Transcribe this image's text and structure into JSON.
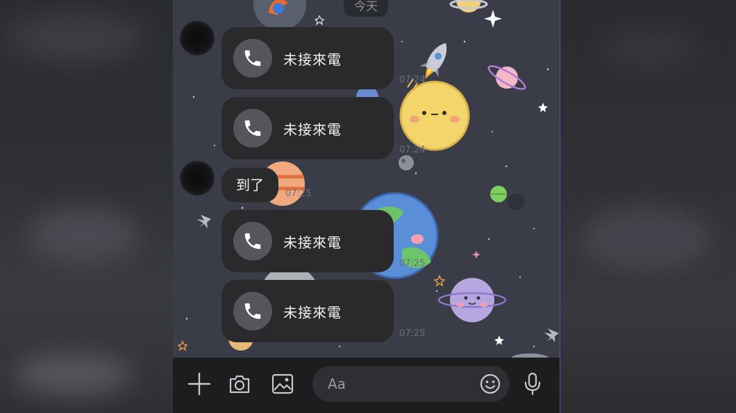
{
  "chat": {
    "date_divider": "今天",
    "messages": [
      {
        "type": "missed_call",
        "label": "未接來電",
        "time": "07:24"
      },
      {
        "type": "missed_call",
        "label": "未接來電",
        "time": "07:24"
      },
      {
        "type": "text",
        "text": "到了",
        "time": "07:25"
      },
      {
        "type": "missed_call",
        "label": "未接來電",
        "time": "07:25"
      },
      {
        "type": "missed_call",
        "label": "未接來電",
        "time": "07:25"
      }
    ]
  },
  "input": {
    "placeholder": "Aa"
  },
  "icons": {
    "add": "plus-icon",
    "camera": "camera-icon",
    "gallery": "image-icon",
    "emoji": "smiley-icon",
    "voice": "microphone-icon",
    "call": "phone-handset-icon"
  },
  "colors": {
    "wallpaper": "#3a3d48",
    "bubble": "#2a2a2d",
    "input_bar": "#1d1d1f",
    "accent_border": "#7b3fa0"
  }
}
